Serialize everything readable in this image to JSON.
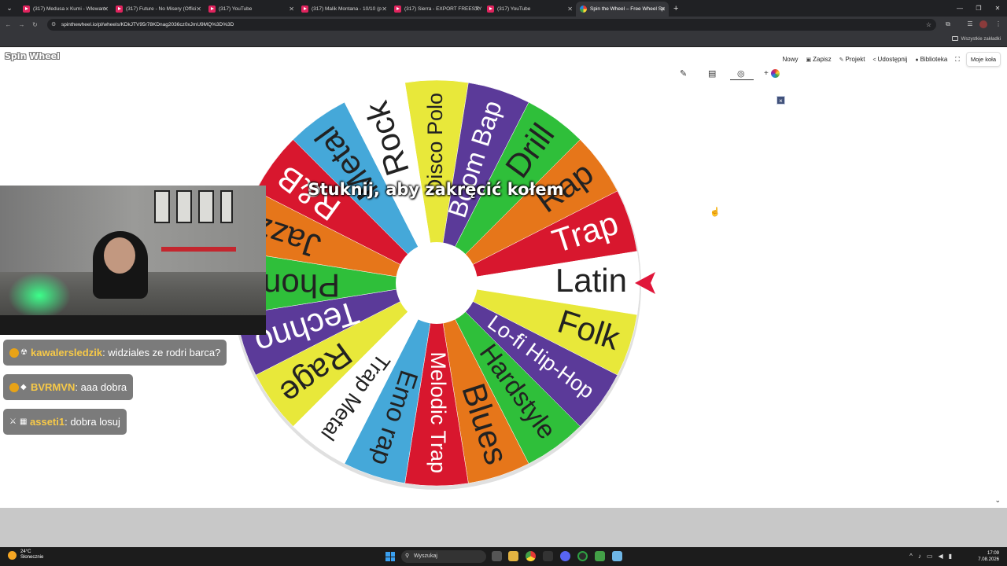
{
  "browser": {
    "tabs": [
      {
        "title": "(317) Medusa x Kumi - Wlewam",
        "favicon": "youtube-icon",
        "active": false
      },
      {
        "title": "(317) Future - No Misery (Offici",
        "favicon": "youtube-icon",
        "active": false
      },
      {
        "title": "(317) YouTube",
        "favicon": "youtube-icon",
        "active": false
      },
      {
        "title": "(317) Malik Montana - 10/10 (p",
        "favicon": "youtube-icon",
        "active": false
      },
      {
        "title": "(317) Sierra - EXPORT FREESTY",
        "favicon": "youtube-icon",
        "active": false
      },
      {
        "title": "(317) YouTube",
        "favicon": "youtube-icon",
        "active": false
      },
      {
        "title": "Spin the Wheel – Free Wheel Sp",
        "favicon": "wheel-icon",
        "active": true
      }
    ],
    "url": "spinthewheel.io/pl/wheels/KDkJTV95r78KDnag2036cz0xJmU9MQ%3D%3D",
    "bookmarks_label": "Wszystkie zakładki"
  },
  "page": {
    "brand": "Spin Wheel",
    "menu": [
      {
        "label": "Nowy",
        "icon": ""
      },
      {
        "label": "Zapisz",
        "icon": "save-icon"
      },
      {
        "label": "Projekt",
        "icon": "brush-icon"
      },
      {
        "label": "Udostępnij",
        "icon": "share-icon"
      },
      {
        "label": "Biblioteka",
        "icon": "library-icon"
      }
    ],
    "my_wheels": "Moje koła",
    "tools": [
      "edit-icon",
      "clipboard-icon",
      "hide-icon",
      "add-color-icon"
    ],
    "add_label": "+",
    "close_label": "×",
    "tap_message": "Stuknij, aby zakręcić kołem",
    "colors": {
      "pointer": "#e0163a"
    },
    "wheel": {
      "rotation_start_deg": -90,
      "segments": [
        {
          "label": "Disco Polo",
          "color": "#e8e83a",
          "text_color": "#222"
        },
        {
          "label": "Boom Bap",
          "color": "#5b3a99",
          "text_color": "#ffffff"
        },
        {
          "label": "Drill",
          "color": "#2fbf3a",
          "text_color": "#222"
        },
        {
          "label": "Rap",
          "color": "#e6761a",
          "text_color": "#222"
        },
        {
          "label": "Trap",
          "color": "#d8172e",
          "text_color": "#ffffff"
        },
        {
          "label": "Latin",
          "color": "#ffffff",
          "text_color": "#222"
        },
        {
          "label": "Folk",
          "color": "#e8e83a",
          "text_color": "#222"
        },
        {
          "label": "Lo-fi Hip-Hop",
          "color": "#5b3a99",
          "text_color": "#ffffff"
        },
        {
          "label": "Hardstyle",
          "color": "#2fbf3a",
          "text_color": "#222"
        },
        {
          "label": "Blues",
          "color": "#e6761a",
          "text_color": "#222"
        },
        {
          "label": "Melodic Trap",
          "color": "#d8172e",
          "text_color": "#ffffff"
        },
        {
          "label": "Emo rap",
          "color": "#45a8d9",
          "text_color": "#222"
        },
        {
          "label": "Trap Metal",
          "color": "#ffffff",
          "text_color": "#222"
        },
        {
          "label": "Rage",
          "color": "#e8e83a",
          "text_color": "#222"
        },
        {
          "label": "Techno",
          "color": "#5b3a99",
          "text_color": "#ffffff"
        },
        {
          "label": "Phonk",
          "color": "#2fbf3a",
          "text_color": "#222"
        },
        {
          "label": "Jazz",
          "color": "#e6761a",
          "text_color": "#222"
        },
        {
          "label": "R&B",
          "color": "#d8172e",
          "text_color": "#ffffff"
        },
        {
          "label": "Metal",
          "color": "#45a8d9",
          "text_color": "#222"
        },
        {
          "label": "Rock",
          "color": "#ffffff",
          "text_color": "#222"
        }
      ]
    }
  },
  "chat": [
    {
      "user": "kawalersledzik",
      "message": "widziales ze rodri barca?"
    },
    {
      "user": "BVRMVN",
      "message": "aaa dobra"
    },
    {
      "user": "asseti1",
      "message": "dobra losuj"
    }
  ],
  "taskbar": {
    "weather_temp": "24°C",
    "weather_desc": "Słonecznie",
    "search_placeholder": "Wyszukaj",
    "time": "17:09",
    "date": "7.08.2026"
  }
}
